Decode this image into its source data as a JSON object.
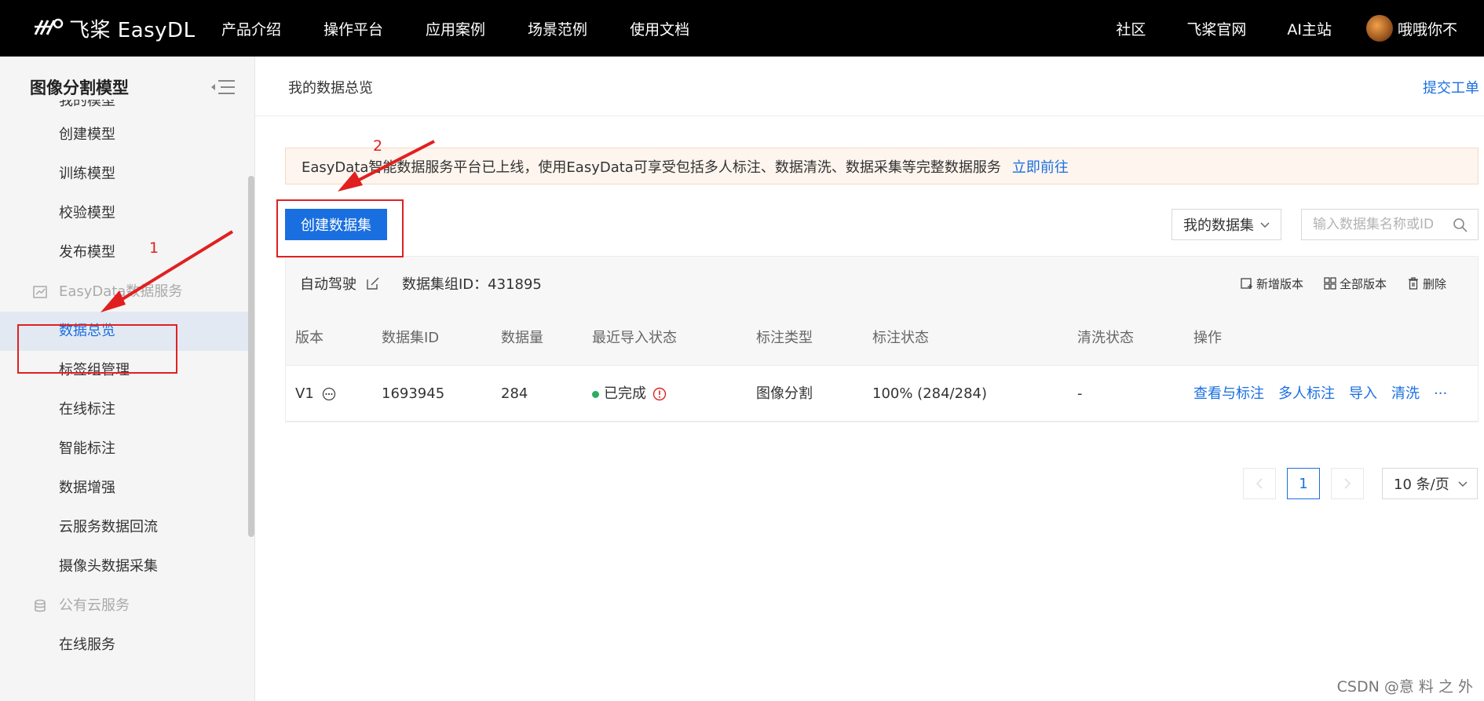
{
  "topbar": {
    "logo_text": "飞桨 EasyDL",
    "nav_left": [
      "产品介绍",
      "操作平台",
      "应用案例",
      "场景范例",
      "使用文档"
    ],
    "nav_right": [
      "社区",
      "飞桨官网",
      "AI主站"
    ],
    "user_name": "哦哦你不"
  },
  "sidebar": {
    "title": "图像分割模型",
    "items": [
      {
        "label": "我的模型",
        "type": "partial"
      },
      {
        "label": "创建模型",
        "type": "item"
      },
      {
        "label": "训练模型",
        "type": "item"
      },
      {
        "label": "校验模型",
        "type": "item"
      },
      {
        "label": "发布模型",
        "type": "item"
      },
      {
        "label": "EasyData数据服务",
        "type": "group",
        "icon": "chart-icon"
      },
      {
        "label": "数据总览",
        "type": "item",
        "active": true
      },
      {
        "label": "标签组管理",
        "type": "item"
      },
      {
        "label": "在线标注",
        "type": "item"
      },
      {
        "label": "智能标注",
        "type": "item"
      },
      {
        "label": "数据增强",
        "type": "item"
      },
      {
        "label": "云服务数据回流",
        "type": "item"
      },
      {
        "label": "摄像头数据采集",
        "type": "item"
      },
      {
        "label": "公有云服务",
        "type": "group",
        "icon": "database-icon"
      },
      {
        "label": "在线服务",
        "type": "item"
      }
    ]
  },
  "main": {
    "breadcrumb": "我的数据总览",
    "ticket_link": "提交工单",
    "notice_text": "EasyData智能数据服务平台已上线，使用EasyData可享受包括多人标注、数据清洗、数据采集等完整数据服务",
    "notice_link": "立即前往",
    "create_button": "创建数据集",
    "filter_select": "我的数据集",
    "search_placeholder": "输入数据集名称或ID"
  },
  "dataset": {
    "name": "自动驾驶",
    "group_id_label": "数据集组ID：431895",
    "actions": [
      "新增版本",
      "全部版本",
      "删除"
    ],
    "columns": [
      "版本",
      "数据集ID",
      "数据量",
      "最近导入状态",
      "标注类型",
      "标注状态",
      "清洗状态",
      "操作"
    ],
    "row": {
      "version": "V1",
      "id": "1693945",
      "count": "284",
      "import_status": "已完成",
      "label_type": "图像分割",
      "label_status": "100% (284/284)",
      "clean_status": "-",
      "ops": [
        "查看与标注",
        "多人标注",
        "导入",
        "清洗",
        "···"
      ]
    }
  },
  "pagination": {
    "current_page": "1",
    "page_size": "10 条/页"
  },
  "annotations": {
    "step1": "1",
    "step2": "2"
  },
  "watermark": "CSDN @意 料 之 外",
  "colors": {
    "accent": "#1a6fe0",
    "topbar": "#000000",
    "annotation": "#e02020",
    "success": "#27ae60"
  }
}
